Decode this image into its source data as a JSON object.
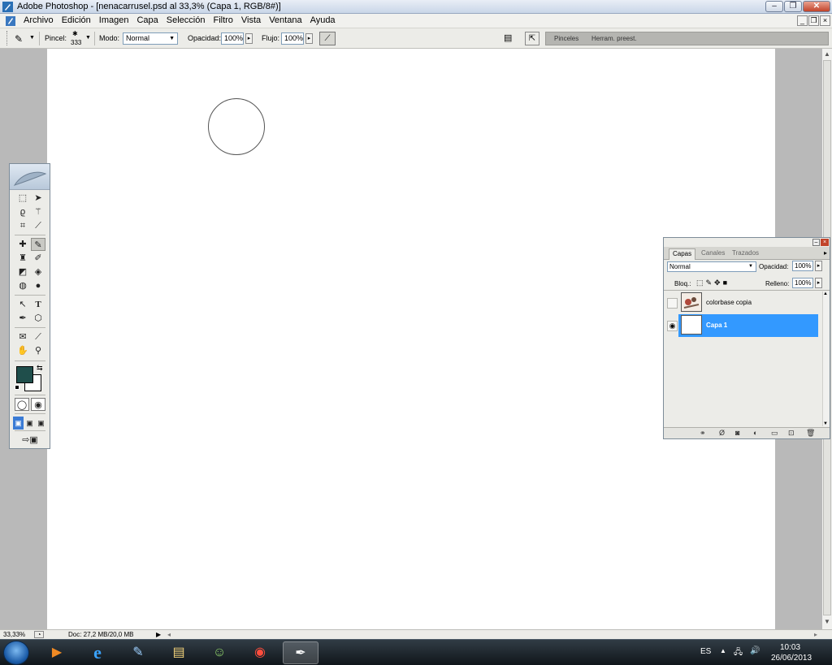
{
  "window": {
    "title": "Adobe Photoshop - [nenacarrusel.psd al 33,3% (Capa 1, RGB/8#)]"
  },
  "menu": [
    "Archivo",
    "Edición",
    "Imagen",
    "Capa",
    "Selección",
    "Filtro",
    "Vista",
    "Ventana",
    "Ayuda"
  ],
  "options": {
    "brush_label": "Pincel:",
    "brush_size": "333",
    "mode_label": "Modo:",
    "mode_value": "Normal",
    "opacity_label": "Opacidad:",
    "opacity_value": "100%",
    "flow_label": "Flujo:",
    "flow_value": "100%",
    "tab_brushes": "Pinceles",
    "tab_presets": "Herram. preest."
  },
  "tools": {
    "foreground_color": "#1f4e4b",
    "background_color": "#ffffff"
  },
  "layers_panel": {
    "tabs": [
      "Capas",
      "Canales",
      "Trazados"
    ],
    "blend_mode": "Normal",
    "opacity_label": "Opacidad:",
    "opacity_value": "100%",
    "lock_label": "Bloq.:",
    "fill_label": "Relleno:",
    "fill_value": "100%",
    "layers": [
      {
        "name": "colorbase copia",
        "visible": false,
        "selected": false
      },
      {
        "name": "Capa 1",
        "visible": true,
        "selected": true
      }
    ]
  },
  "status": {
    "zoom": "33,33%",
    "doc_info": "Doc: 27,2 MB/20,0 MB"
  },
  "taskbar": {
    "language": "ES",
    "time": "10:03",
    "date": "26/06/2013"
  }
}
